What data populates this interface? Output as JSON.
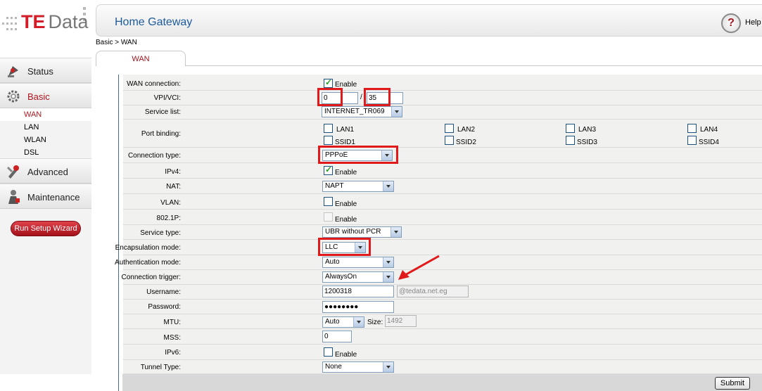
{
  "logo": {
    "brand_te": "TE",
    "brand_data": "Data"
  },
  "header": {
    "title": "Home Gateway",
    "help_label": "Help",
    "help_symbol": "?"
  },
  "breadcrumb": "Basic > WAN",
  "tabs": [
    {
      "label": "WAN",
      "active": true
    }
  ],
  "sidebar": {
    "groups": [
      {
        "label": "Status",
        "icon": "status-icon"
      },
      {
        "label": "Basic",
        "icon": "gear-icon",
        "active": true
      },
      {
        "label": "Advanced",
        "icon": "tools-icon"
      },
      {
        "label": "Maintenance",
        "icon": "maintenance-icon"
      }
    ],
    "basic_items": [
      {
        "label": "WAN",
        "active": true
      },
      {
        "label": "LAN"
      },
      {
        "label": "WLAN"
      },
      {
        "label": "DSL"
      }
    ],
    "wizard_label": "Run Setup Wizard"
  },
  "form": {
    "wan_connection": {
      "label": "WAN connection:",
      "checkbox_label": "Enable",
      "checked": true
    },
    "vpi_vci": {
      "label": "VPI/VCI:",
      "vpi": "0",
      "separator": "/",
      "vci": "35"
    },
    "service_list": {
      "label": "Service list:",
      "value": "INTERNET_TR069"
    },
    "port_binding": {
      "label": "Port binding:",
      "ports": [
        "LAN1",
        "LAN2",
        "LAN3",
        "LAN4",
        "SSID1",
        "SSID2",
        "SSID3",
        "SSID4"
      ]
    },
    "connection_type": {
      "label": "Connection type:",
      "value": "PPPoE"
    },
    "ipv4": {
      "label": "IPv4:",
      "checkbox_label": "Enable",
      "checked": true
    },
    "nat": {
      "label": "NAT:",
      "value": "NAPT"
    },
    "vlan": {
      "label": "VLAN:",
      "checkbox_label": "Enable",
      "checked": false
    },
    "p8021": {
      "label": "802.1P:",
      "checkbox_label": "Enable",
      "checked": false
    },
    "service_type": {
      "label": "Service type:",
      "value": "UBR without PCR"
    },
    "encapsulation": {
      "label": "Encapsulation mode:",
      "value": "LLC"
    },
    "auth_mode": {
      "label": "Authentication mode:",
      "value": "Auto"
    },
    "connection_trigger": {
      "label": "Connection trigger:",
      "value": "AlwaysOn"
    },
    "username": {
      "label": "Username:",
      "value": "1200318",
      "domain_suffix": "@tedata.net.eg"
    },
    "password": {
      "label": "Password:",
      "value": "●●●●●●●●"
    },
    "mtu": {
      "label": "MTU:",
      "value": "Auto",
      "size_label": "Size:",
      "size_value": "1492"
    },
    "mss": {
      "label": "MSS:",
      "value": "0"
    },
    "ipv6": {
      "label": "IPv6:",
      "checkbox_label": "Enable",
      "checked": false
    },
    "tunnel_type": {
      "label": "Tunnel Type:",
      "value": "None"
    }
  },
  "submit_label": "Submit",
  "colors": {
    "accent_red": "#b0151f",
    "highlight": "#e01a1a",
    "title_blue": "#1d5b9c"
  }
}
